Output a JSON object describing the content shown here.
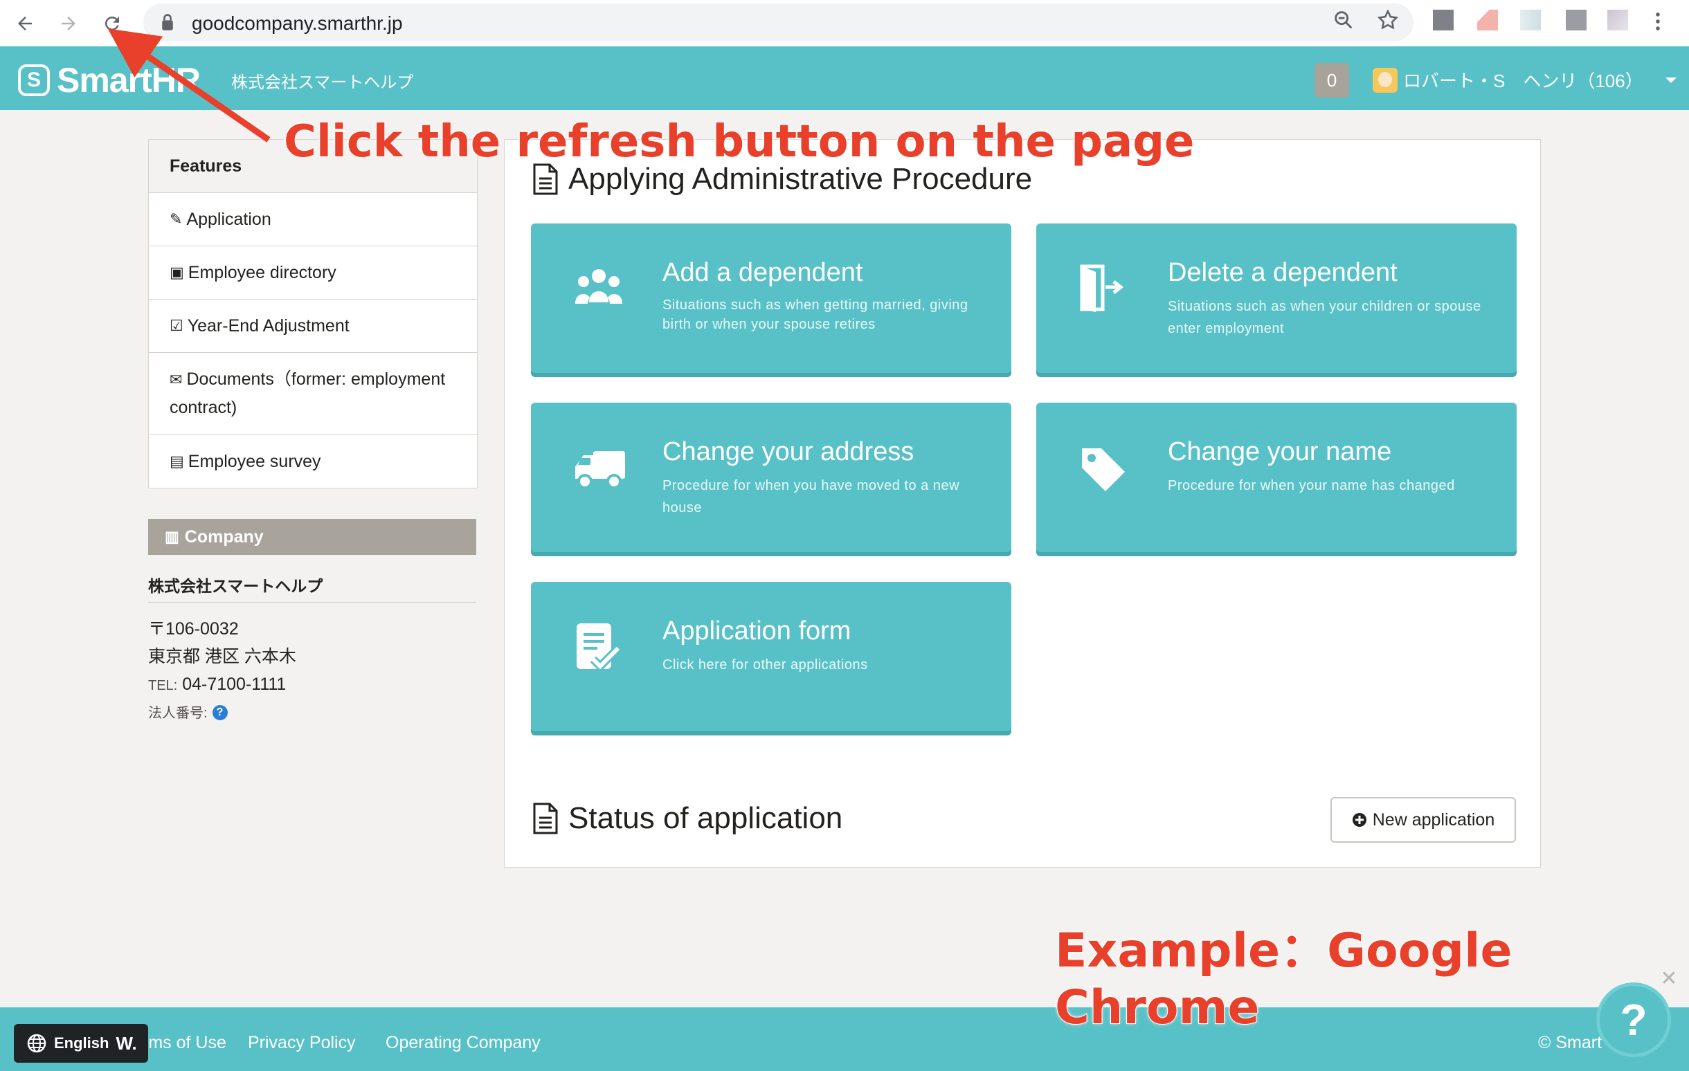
{
  "browser": {
    "url": "goodcompany.smarthr.jp"
  },
  "header": {
    "logo_text": "SmartHR",
    "company_name": "株式会社スマートヘルプ",
    "notification_count": "0",
    "user_name": "ロバート・S　ヘンリ（106）"
  },
  "sidebar": {
    "features_title": "Features",
    "items": [
      {
        "label": "Application"
      },
      {
        "label": "Employee directory"
      },
      {
        "label": "Year-End Adjustment"
      },
      {
        "label": "Documents（former: employment contract)"
      },
      {
        "label": "Employee survey"
      }
    ],
    "company_title": "Company",
    "company": {
      "name": "株式会社スマートヘルプ",
      "postal": "〒106-0032",
      "address": "東京都 港区 六本木",
      "tel_label": "TEL:",
      "tel": "04-7100-1111",
      "corp_number_label": "法人番号:"
    }
  },
  "main": {
    "procedure_title": "Applying Administrative Procedure",
    "cards": [
      {
        "title": "Add a dependent",
        "desc": "Situations such as when getting married, giving birth or when your spouse retires",
        "icon": "people-group-icon"
      },
      {
        "title": "Delete a dependent",
        "desc": "Situations such as when your children or spouse enter employment",
        "icon": "door-exit-icon"
      },
      {
        "title": "Change your address",
        "desc": "Procedure for when you have moved to a new house",
        "icon": "truck-icon"
      },
      {
        "title": "Change your name",
        "desc": "Procedure for when your name has changed",
        "icon": "tag-icon"
      },
      {
        "title": "Application form",
        "desc": "Click here for other applications",
        "icon": "form-check-icon"
      }
    ],
    "status_title": "Status of application",
    "new_application_label": "New application"
  },
  "footer": {
    "terms": "rms of Use",
    "privacy": "Privacy Policy",
    "operating": "Operating Company",
    "copyright": "© Smart",
    "language": "English"
  },
  "annotations": {
    "instruction": "Click the refresh button on the page",
    "example": "Example：Google Chrome"
  },
  "colors": {
    "brand": "#58c1c7",
    "annotation": "#e8402a"
  }
}
